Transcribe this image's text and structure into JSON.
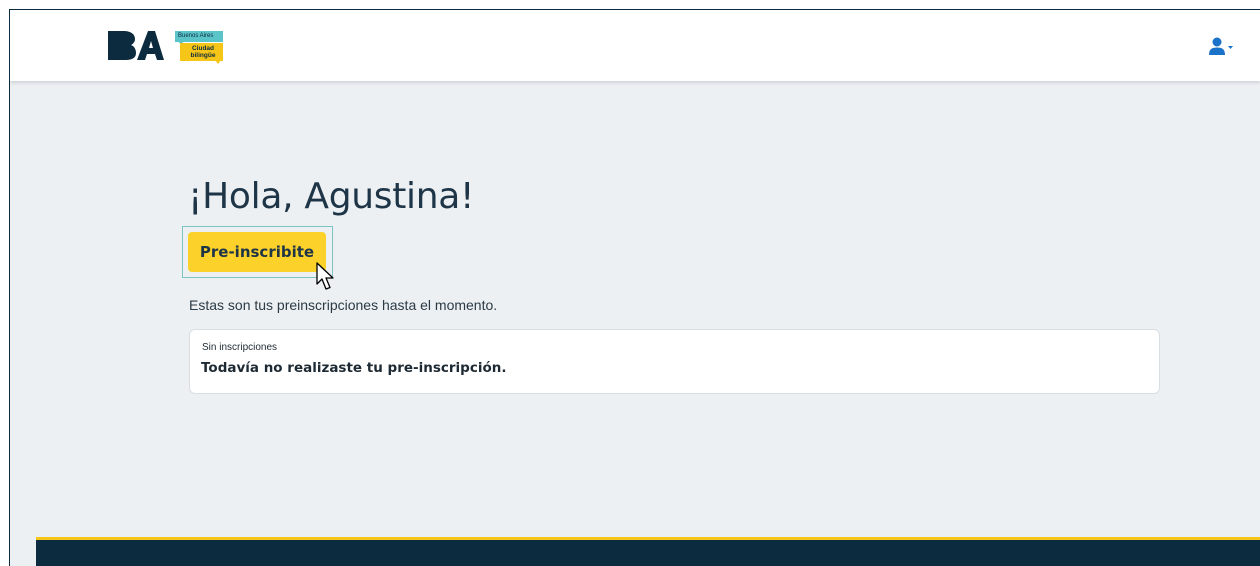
{
  "header": {
    "logo_text": "BA",
    "badge": {
      "top_text": "Buenos Aires",
      "bottom_line1": "Ciudad",
      "bottom_line2": "bilingüe"
    },
    "user_menu_icon": "user-icon"
  },
  "main": {
    "greeting": "¡Hola, Agustina!",
    "preinscribite_label": "Pre-inscribite",
    "intro_text": "Estas son tus preinscripciones hasta el momento.",
    "card": {
      "label": "Sin inscripciones",
      "message": "Todavía no realizaste tu pre-inscripción."
    }
  },
  "colors": {
    "brand_dark": "#0d2b3e",
    "accent_yellow": "#fcd12a",
    "accent_teal": "#5bc4c9",
    "page_bg": "#ecf0f3",
    "user_icon": "#1a73c9"
  }
}
